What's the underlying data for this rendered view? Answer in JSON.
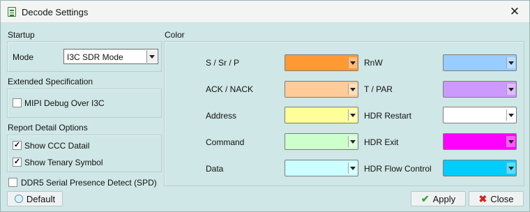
{
  "window": {
    "title": "Decode Settings",
    "app_icon": "document-list-icon",
    "close_icon": "close-icon",
    "close_glyph": "✕"
  },
  "startup": {
    "group_title": "Startup",
    "mode_label": "Mode",
    "mode_value": "I3C SDR Mode"
  },
  "extended": {
    "group_title": "Extended Specification",
    "mipi_label": "MIPI Debug Over I3C",
    "mipi_checked": false
  },
  "report": {
    "group_title": "Report Detail Options",
    "show_ccc_label": "Show CCC Datail",
    "show_ccc_checked": true,
    "show_tenary_label": "Show Tenary Symbol",
    "show_tenary_checked": true
  },
  "ddr5": {
    "label": "DDR5 Serial Presence Detect (SPD)",
    "checked": false
  },
  "color": {
    "group_title": "Color",
    "left": [
      {
        "label": "S / Sr / P",
        "color": "#ff9933"
      },
      {
        "label": "ACK / NACK",
        "color": "#ffcc99"
      },
      {
        "label": "Address",
        "color": "#ffff99"
      },
      {
        "label": "Command",
        "color": "#ccffcc"
      },
      {
        "label": "Data",
        "color": "#ccffff"
      }
    ],
    "right": [
      {
        "label": "RnW",
        "color": "#99ccff"
      },
      {
        "label": "T / PAR",
        "color": "#cc99ff"
      },
      {
        "label": "HDR Restart",
        "color": "#ffffff"
      },
      {
        "label": "HDR Exit",
        "color": "#ff00ff"
      },
      {
        "label": "HDR Flow Control",
        "color": "#00ccff"
      }
    ]
  },
  "buttons": {
    "default_label": "Default",
    "apply_label": "Apply",
    "close_label": "Close",
    "check_glyph": "✔",
    "x_glyph": "✖"
  }
}
